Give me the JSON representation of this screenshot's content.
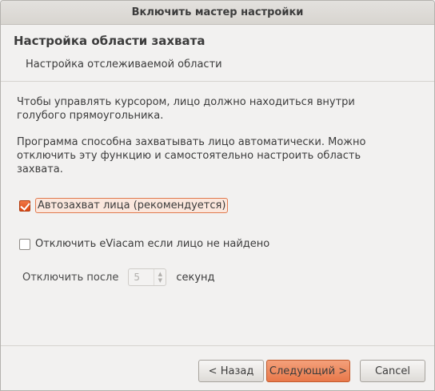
{
  "window": {
    "title": "Включить мастер настройки"
  },
  "page": {
    "heading": "Настройка области захвата",
    "subheading": "Настройка отслеживаемой области",
    "paragraph1_line1": "Чтобы управлять курсором, лицо должно находиться внутри",
    "paragraph1_line2": "голубого прямоугольника.",
    "paragraph2_line1": "Программа способна захватывать лицо автоматически. Можно",
    "paragraph2_line2": "отключить эту функцию и самостоятельно настроить область",
    "paragraph2_line3": "захвата."
  },
  "options": {
    "auto_capture": {
      "label": "Автозахват лица (рекомендуется)",
      "checked": true
    },
    "disable_if_no_face": {
      "label": "Отключить eViacam если лицо не найдено",
      "checked": false
    },
    "disable_after": {
      "label_before": "Отключить после",
      "value": "5",
      "label_after": "секунд",
      "enabled": false
    }
  },
  "buttons": {
    "back": "< Назад",
    "next": "Следующий >",
    "cancel": "Cancel"
  },
  "colors": {
    "accent": "#dd4814",
    "default_button": "#e8784a"
  }
}
